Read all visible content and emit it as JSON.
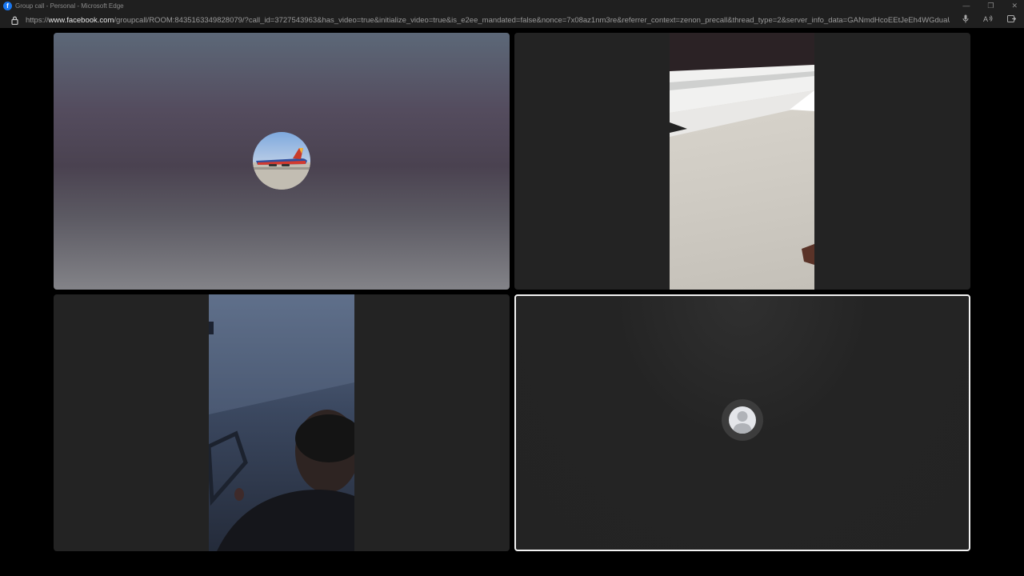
{
  "browser": {
    "window_title": "Group call - Personal - Microsoft Edge",
    "url_prefix": "https://",
    "url_domain": "www.facebook.com",
    "url_rest": "/groupcall/ROOM:8435163349828079/?call_id=3727543963&has_video=true&initialize_video=true&is_e2ee_mandated=false&nonce=7x08az1nm3re&referrer_context=zenon_precall&thread_type=2&server_info_data=GANmdHcoEEtJeEh4WGduaUpIbE...",
    "icons": [
      "facebook-favicon",
      "lock-icon",
      "microphone-icon",
      "read-aloud-icon",
      "extension-icon"
    ]
  },
  "call": {
    "participants": [
      {
        "tile": "top-left",
        "display": "profile-picture",
        "picture": "airplane-on-runway"
      },
      {
        "tile": "top-right",
        "display": "video",
        "content": "ceiling-and-wall"
      },
      {
        "tile": "bottom-left",
        "display": "video",
        "content": "person-in-dim-room"
      },
      {
        "tile": "bottom-right",
        "display": "default-avatar",
        "active_speaker": true
      }
    ],
    "colors": {
      "background": "#000000",
      "tile": "#232323",
      "active_border": "#f2f2f2",
      "favicon": "#1877f2"
    }
  }
}
